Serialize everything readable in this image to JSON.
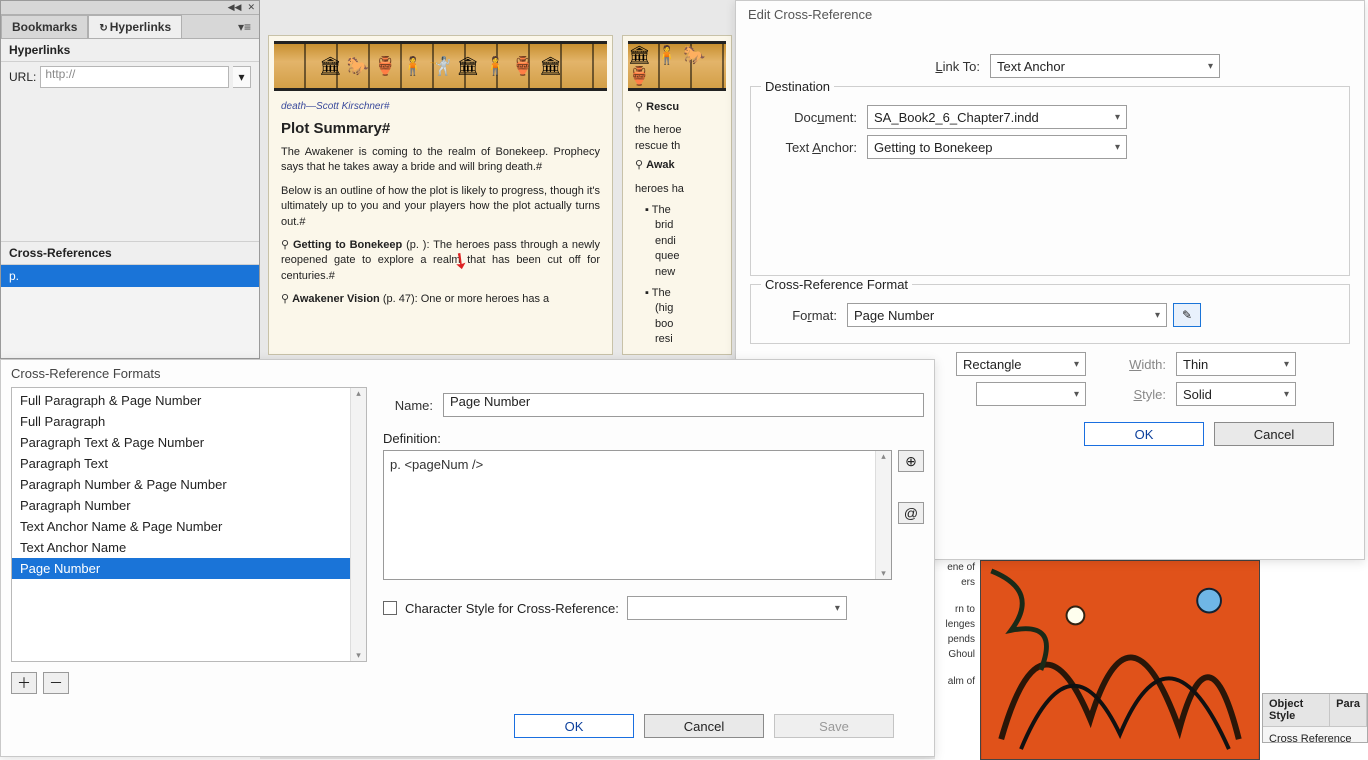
{
  "hyperPanel": {
    "tabs": {
      "bookmarks": "Bookmarks",
      "hyperlinks": "Hyperlinks"
    },
    "sectionHyperlinks": "Hyperlinks",
    "urlLabel": "URL:",
    "urlPlaceholder": "http://",
    "sectionXRef": "Cross-References",
    "xrefItem": "p."
  },
  "document": {
    "author": "death—Scott Kirschner#",
    "heading": "Plot Summary",
    "para1": "The Awakener is coming to the realm of Bonekeep. Prophecy says that he takes away a bride and will bring death.#",
    "para2": "Below is an outline of how the plot is likely to progress, though it's ultimately up to you and your players how the plot actually turns out.#",
    "gtb_title": "Getting to Bonekeep",
    "gtb_body": " (p. ): The heroes pass through a newly reopened gate to explore a realm that has been cut off for centuries.#",
    "av_title": "Awakener Vision",
    "av_body": " (p. 47): One or more heroes has a",
    "right_rescue": "Rescu",
    "right_line1": "the heroe",
    "right_line2": "rescue th",
    "right_awak": "Awak",
    "right_line3": "heroes ha",
    "right_b1a": "The",
    "right_b1b": "brid",
    "right_b1c": "endi",
    "right_b1d": "quee",
    "right_b1e": "new",
    "right_b2a": "The",
    "right_b2b": "(hig",
    "right_b2c": "boo",
    "right_b2d": "resi"
  },
  "editXRef": {
    "title": "Edit Cross-Reference",
    "linkToLabel": "Link To:",
    "linkToValue": "Text Anchor",
    "destinationLegend": "Destination",
    "documentLabel": "Document:",
    "documentValue": "SA_Book2_6_Chapter7.indd",
    "textAnchorLabel": "Text Anchor:",
    "textAnchorValue": "Getting to Bonekeep",
    "xrefFormatLegend": "Cross-Reference Format",
    "formatLabel": "Format:",
    "formatValue": "Page Number",
    "rectangleValue": "Rectangle",
    "widthLabel": "Width:",
    "widthValue": "Thin",
    "styleLabel": "Style:",
    "styleValue": "Solid",
    "ok": "OK",
    "cancel": "Cancel"
  },
  "xrFormats": {
    "title": "Cross-Reference Formats",
    "items": [
      "Full Paragraph & Page Number",
      "Full Paragraph",
      "Paragraph Text & Page Number",
      "Paragraph Text",
      "Paragraph Number & Page Number",
      "Paragraph Number",
      "Text Anchor Name & Page Number",
      "Text Anchor Name",
      "Page Number"
    ],
    "selectedIndex": 8,
    "nameLabel": "Name:",
    "nameValue": "Page Number",
    "definitionLabel": "Definition:",
    "definitionValue": "p. <pageNum />",
    "charStyleLabel": "Character Style for Cross-Reference:",
    "ok": "OK",
    "cancel": "Cancel",
    "save": "Save"
  },
  "objPanel": {
    "tab1": "Object Style",
    "tab2": "Para",
    "row": "Cross Reference Tex"
  },
  "snippet": {
    "l1": "ene of",
    "l2": "ers",
    "l3": "rn to",
    "l4": "lenges",
    "l5": "pends",
    "l6": "Ghoul",
    "l7": "alm of"
  }
}
